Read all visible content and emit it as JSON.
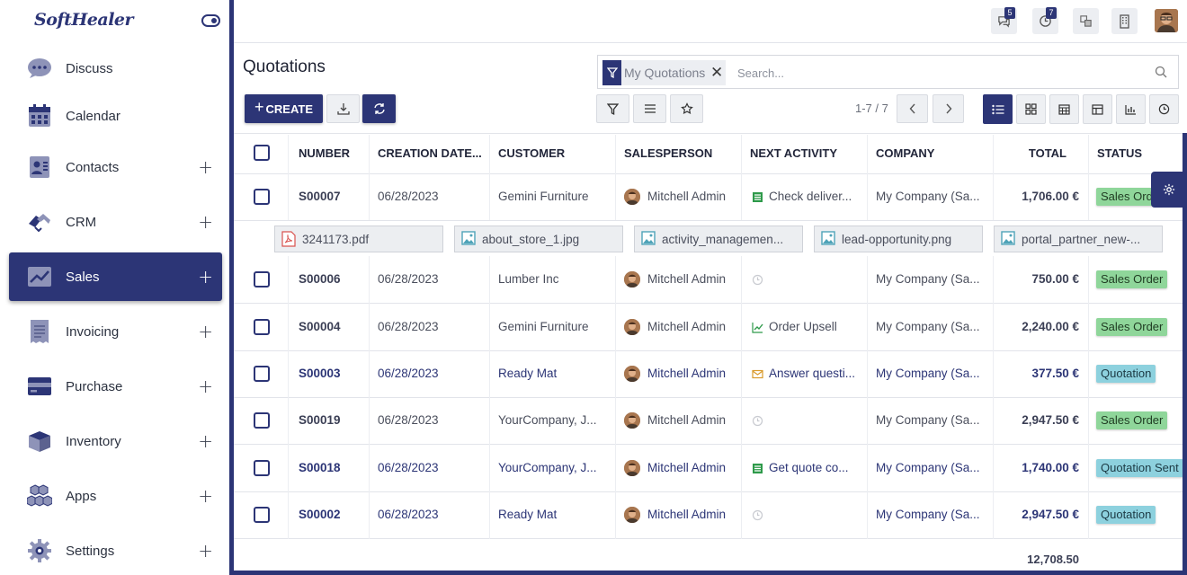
{
  "app": {
    "logo_text": "SoftHealer"
  },
  "sidebar": {
    "items": [
      {
        "label": "Discuss",
        "icon": "chat-bubble-icon",
        "has_plus": false,
        "active": false
      },
      {
        "label": "Calendar",
        "icon": "calendar-icon",
        "has_plus": false,
        "active": false
      },
      {
        "label": "Contacts",
        "icon": "contacts-card-icon",
        "has_plus": true,
        "active": false
      },
      {
        "label": "CRM",
        "icon": "handshake-icon",
        "has_plus": true,
        "active": false
      },
      {
        "label": "Sales",
        "icon": "sales-chart-icon",
        "has_plus": true,
        "active": true
      },
      {
        "label": "Invoicing",
        "icon": "receipt-icon",
        "has_plus": true,
        "active": false
      },
      {
        "label": "Purchase",
        "icon": "credit-card-icon",
        "has_plus": true,
        "active": false
      },
      {
        "label": "Inventory",
        "icon": "box-icon",
        "has_plus": true,
        "active": false
      },
      {
        "label": "Apps",
        "icon": "cubes-icon",
        "has_plus": true,
        "active": false
      },
      {
        "label": "Settings",
        "icon": "gear-icon",
        "has_plus": true,
        "active": false
      }
    ],
    "plus_label": "+"
  },
  "topbar": {
    "messages_count": "5",
    "activities_count": "7"
  },
  "control": {
    "title": "Quotations",
    "facet_label": "My Quotations",
    "facet_close": "✕",
    "search_placeholder": "Search...",
    "create_label": "CREATE",
    "create_plus": "+",
    "pager": "1-7 / 7"
  },
  "table": {
    "headers": [
      "NUMBER",
      "CREATION DATE...",
      "CUSTOMER",
      "SALESPERSON",
      "NEXT ACTIVITY",
      "COMPANY",
      "TOTAL",
      "STATUS"
    ],
    "rows": [
      {
        "number": "S00007",
        "date": "06/28/2023",
        "customer": "Gemini Furniture",
        "salesperson": "Mitchell Admin",
        "activity": "Check deliver...",
        "activity_icon": "task-list-icon",
        "company": "My Company (Sa...",
        "total": "1,706.00 €",
        "status": "Sales Orde",
        "status_type": "so",
        "highlight": false
      },
      {
        "number": "S00006",
        "date": "06/28/2023",
        "customer": "Lumber Inc",
        "salesperson": "Mitchell Admin",
        "activity": "",
        "activity_icon": "clock-icon",
        "company": "My Company (Sa...",
        "total": "750.00 €",
        "status": "Sales Order",
        "status_type": "so",
        "highlight": false
      },
      {
        "number": "S00004",
        "date": "06/28/2023",
        "customer": "Gemini Furniture",
        "salesperson": "Mitchell Admin",
        "activity": "Order Upsell",
        "activity_icon": "trend-icon",
        "company": "My Company (Sa...",
        "total": "2,240.00 €",
        "status": "Sales Order",
        "status_type": "so",
        "highlight": false
      },
      {
        "number": "S00003",
        "date": "06/28/2023",
        "customer": "Ready Mat",
        "salesperson": "Mitchell Admin",
        "activity": "Answer questi...",
        "activity_icon": "envelope-icon",
        "company": "My Company (Sa...",
        "total": "377.50 €",
        "status": "Quotation",
        "status_type": "q",
        "highlight": true
      },
      {
        "number": "S00019",
        "date": "06/28/2023",
        "customer": "YourCompany, J...",
        "salesperson": "Mitchell Admin",
        "activity": "",
        "activity_icon": "clock-icon",
        "company": "My Company (Sa...",
        "total": "2,947.50 €",
        "status": "Sales Order",
        "status_type": "so",
        "highlight": false
      },
      {
        "number": "S00018",
        "date": "06/28/2023",
        "customer": "YourCompany, J...",
        "salesperson": "Mitchell Admin",
        "activity": "Get quote co...",
        "activity_icon": "task-list-icon",
        "company": "My Company (Sa...",
        "total": "1,740.00 €",
        "status": "Quotation Sent",
        "status_type": "q",
        "highlight": true
      },
      {
        "number": "S00002",
        "date": "06/28/2023",
        "customer": "Ready Mat",
        "salesperson": "Mitchell Admin",
        "activity": "",
        "activity_icon": "clock-icon",
        "company": "My Company (Sa...",
        "total": "2,947.50 €",
        "status": "Quotation",
        "status_type": "q",
        "highlight": true
      }
    ],
    "attachments": [
      {
        "name": "3241173.pdf",
        "type": "pdf"
      },
      {
        "name": "about_store_1.jpg",
        "type": "image"
      },
      {
        "name": "activity_managemen...",
        "type": "image"
      },
      {
        "name": "lead-opportunity.png",
        "type": "image"
      },
      {
        "name": "portal_partner_new-...",
        "type": "image"
      }
    ],
    "grand_total": "12,708.50"
  },
  "colors": {
    "brand": "#2c3576",
    "sales_order": "#8fd69a",
    "quotation": "#8dd1de"
  }
}
